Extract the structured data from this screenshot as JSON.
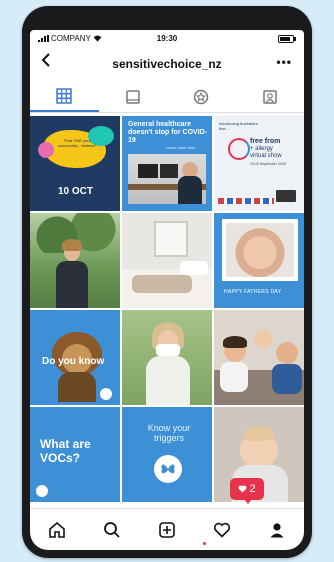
{
  "status": {
    "carrier": "COMPANY",
    "time": "19:30"
  },
  "header": {
    "username": "sensitivechoice_nz",
    "more": "•••"
  },
  "posts": {
    "p1": {
      "quote": "\"Find ONE your community... Asthma\"",
      "date": "10 OCT"
    },
    "p2": {
      "title": "General healthcare doesn't stop for COVID-19",
      "sub": "Learn more here"
    },
    "p3": {
      "intro": "Introducing Australia's first...",
      "free": "free from",
      "allergy": "+ allergy",
      "show": "virtual show",
      "date": "19-20 September 2020"
    },
    "p6": {
      "caption": "HAPPY FATHERS DAY"
    },
    "p7": {
      "title": "Do you know"
    },
    "p10": {
      "title": "What are VOCs?"
    },
    "p11": {
      "title": "Know your triggers"
    }
  },
  "notification": {
    "count": "2"
  },
  "colors": {
    "brand_blue": "#3d8fd6",
    "accent_red": "#e8314a",
    "tab_active": "#3a7bd5"
  }
}
